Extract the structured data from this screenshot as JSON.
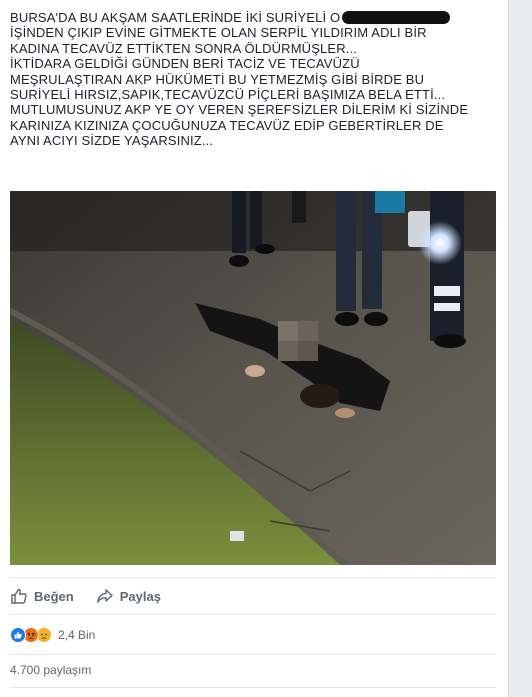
{
  "post": {
    "lines": [
      "BURSA'DA BU AKŞAM SAATLERİNDE İKİ SURİYELİ O",
      "İŞİNDEN ÇIKIP EVİNE GİTMEKTE OLAN SERPİL YILDIRIM ADLI BİR",
      "KADINA TECAVÜZ ETTİKTEN SONRA ÖLDÜRMÜŞLER...",
      "İKTİDARA GELDİĞİ GÜNDEN BERİ TACİZ VE TECAVÜZÜ",
      "MEŞRULAŞTIRAN AKP HÜKÜMETİ BU YETMEZMİŞ GİBİ BİRDE BU",
      "SURİYELİ HIRSIZ,SAPIK,TECAVÜZCÜ PİÇLERİ BAŞIMIZA BELA ETTİ...",
      "MUTLUMUSUNUZ AKP YE OY VEREN ŞEREFSİZLER DİLERİM Kİ SİZİNDE",
      "KARINIZA KIZINIZA ÇOCUĞUNUZA TECAVÜZ EDİP GEBERTİRLER DE",
      "AYNI ACIYI SİZDE YAŞARSINIZ..."
    ]
  },
  "actions": {
    "like_label": "Beğen",
    "share_label": "Paylaş"
  },
  "reactions": {
    "icons": [
      "like-icon",
      "angry-icon",
      "sad-icon"
    ],
    "count": "2,4 Bin"
  },
  "shares": {
    "count_label": "4.700 paylaşım"
  },
  "colors": {
    "text": "#1d2129",
    "secondary": "#606770",
    "like_blue": "#1877f2",
    "page_bg": "#e9ebee"
  }
}
